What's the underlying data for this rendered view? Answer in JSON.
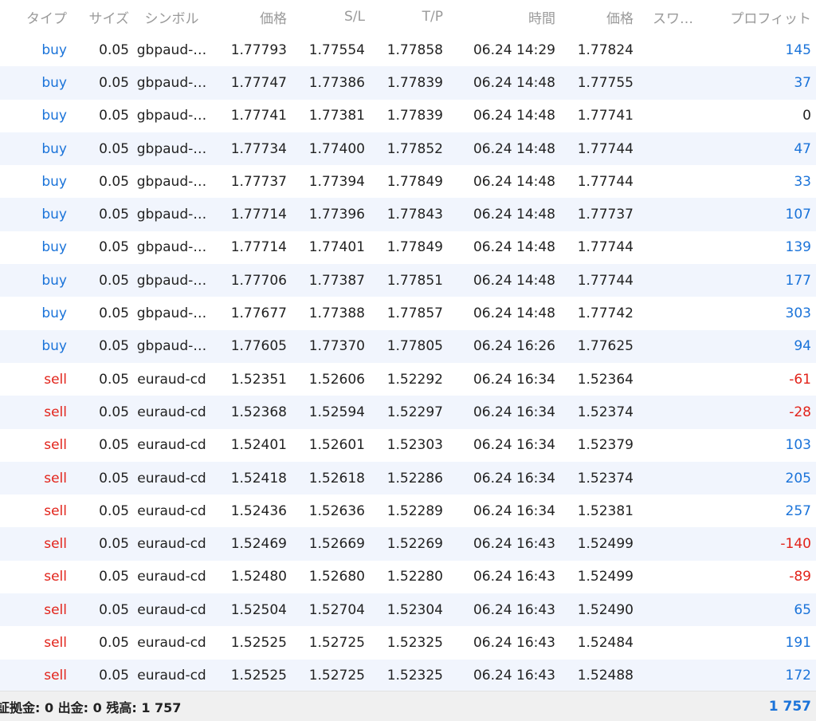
{
  "headers": {
    "type": "タイプ",
    "size": "サイズ",
    "symbol": "シンボル",
    "price": "価格",
    "sl": "S/L",
    "tp": "T/P",
    "time": "時間",
    "current_price": "価格",
    "swap": "スワ…",
    "profit": "プロフィット"
  },
  "rows": [
    {
      "type": "buy",
      "size": "0.05",
      "symbol": "gbpaud-…",
      "price": "1.77793",
      "sl": "1.77554",
      "tp": "1.77858",
      "time": "06.24 14:29",
      "current_price": "1.77824",
      "swap": "",
      "profit": "145"
    },
    {
      "type": "buy",
      "size": "0.05",
      "symbol": "gbpaud-…",
      "price": "1.77747",
      "sl": "1.77386",
      "tp": "1.77839",
      "time": "06.24 14:48",
      "current_price": "1.77755",
      "swap": "",
      "profit": "37"
    },
    {
      "type": "buy",
      "size": "0.05",
      "symbol": "gbpaud-…",
      "price": "1.77741",
      "sl": "1.77381",
      "tp": "1.77839",
      "time": "06.24 14:48",
      "current_price": "1.77741",
      "swap": "",
      "profit": "0"
    },
    {
      "type": "buy",
      "size": "0.05",
      "symbol": "gbpaud-…",
      "price": "1.77734",
      "sl": "1.77400",
      "tp": "1.77852",
      "time": "06.24 14:48",
      "current_price": "1.77744",
      "swap": "",
      "profit": "47"
    },
    {
      "type": "buy",
      "size": "0.05",
      "symbol": "gbpaud-…",
      "price": "1.77737",
      "sl": "1.77394",
      "tp": "1.77849",
      "time": "06.24 14:48",
      "current_price": "1.77744",
      "swap": "",
      "profit": "33"
    },
    {
      "type": "buy",
      "size": "0.05",
      "symbol": "gbpaud-…",
      "price": "1.77714",
      "sl": "1.77396",
      "tp": "1.77843",
      "time": "06.24 14:48",
      "current_price": "1.77737",
      "swap": "",
      "profit": "107"
    },
    {
      "type": "buy",
      "size": "0.05",
      "symbol": "gbpaud-…",
      "price": "1.77714",
      "sl": "1.77401",
      "tp": "1.77849",
      "time": "06.24 14:48",
      "current_price": "1.77744",
      "swap": "",
      "profit": "139"
    },
    {
      "type": "buy",
      "size": "0.05",
      "symbol": "gbpaud-…",
      "price": "1.77706",
      "sl": "1.77387",
      "tp": "1.77851",
      "time": "06.24 14:48",
      "current_price": "1.77744",
      "swap": "",
      "profit": "177"
    },
    {
      "type": "buy",
      "size": "0.05",
      "symbol": "gbpaud-…",
      "price": "1.77677",
      "sl": "1.77388",
      "tp": "1.77857",
      "time": "06.24 14:48",
      "current_price": "1.77742",
      "swap": "",
      "profit": "303"
    },
    {
      "type": "buy",
      "size": "0.05",
      "symbol": "gbpaud-…",
      "price": "1.77605",
      "sl": "1.77370",
      "tp": "1.77805",
      "time": "06.24 16:26",
      "current_price": "1.77625",
      "swap": "",
      "profit": "94"
    },
    {
      "type": "sell",
      "size": "0.05",
      "symbol": "euraud-cd",
      "price": "1.52351",
      "sl": "1.52606",
      "tp": "1.52292",
      "time": "06.24 16:34",
      "current_price": "1.52364",
      "swap": "",
      "profit": "-61"
    },
    {
      "type": "sell",
      "size": "0.05",
      "symbol": "euraud-cd",
      "price": "1.52368",
      "sl": "1.52594",
      "tp": "1.52297",
      "time": "06.24 16:34",
      "current_price": "1.52374",
      "swap": "",
      "profit": "-28"
    },
    {
      "type": "sell",
      "size": "0.05",
      "symbol": "euraud-cd",
      "price": "1.52401",
      "sl": "1.52601",
      "tp": "1.52303",
      "time": "06.24 16:34",
      "current_price": "1.52379",
      "swap": "",
      "profit": "103"
    },
    {
      "type": "sell",
      "size": "0.05",
      "symbol": "euraud-cd",
      "price": "1.52418",
      "sl": "1.52618",
      "tp": "1.52286",
      "time": "06.24 16:34",
      "current_price": "1.52374",
      "swap": "",
      "profit": "205"
    },
    {
      "type": "sell",
      "size": "0.05",
      "symbol": "euraud-cd",
      "price": "1.52436",
      "sl": "1.52636",
      "tp": "1.52289",
      "time": "06.24 16:34",
      "current_price": "1.52381",
      "swap": "",
      "profit": "257"
    },
    {
      "type": "sell",
      "size": "0.05",
      "symbol": "euraud-cd",
      "price": "1.52469",
      "sl": "1.52669",
      "tp": "1.52269",
      "time": "06.24 16:43",
      "current_price": "1.52499",
      "swap": "",
      "profit": "-140"
    },
    {
      "type": "sell",
      "size": "0.05",
      "symbol": "euraud-cd",
      "price": "1.52480",
      "sl": "1.52680",
      "tp": "1.52280",
      "time": "06.24 16:43",
      "current_price": "1.52499",
      "swap": "",
      "profit": "-89"
    },
    {
      "type": "sell",
      "size": "0.05",
      "symbol": "euraud-cd",
      "price": "1.52504",
      "sl": "1.52704",
      "tp": "1.52304",
      "time": "06.24 16:43",
      "current_price": "1.52490",
      "swap": "",
      "profit": "65"
    },
    {
      "type": "sell",
      "size": "0.05",
      "symbol": "euraud-cd",
      "price": "1.52525",
      "sl": "1.52725",
      "tp": "1.52325",
      "time": "06.24 16:43",
      "current_price": "1.52484",
      "swap": "",
      "profit": "191"
    },
    {
      "type": "sell",
      "size": "0.05",
      "symbol": "euraud-cd",
      "price": "1.52525",
      "sl": "1.52725",
      "tp": "1.52325",
      "time": "06.24 16:43",
      "current_price": "1.52488",
      "swap": "",
      "profit": "172"
    }
  ],
  "footer": {
    "summary": "証拠金: 0 出金: 0 残高: 1 757",
    "total": "1 757"
  },
  "colors": {
    "buy": "#1a73d9",
    "sell": "#e2231a",
    "profit_positive": "#1a73d9",
    "profit_negative": "#e2231a",
    "row_alt": "#f1f5fd"
  }
}
